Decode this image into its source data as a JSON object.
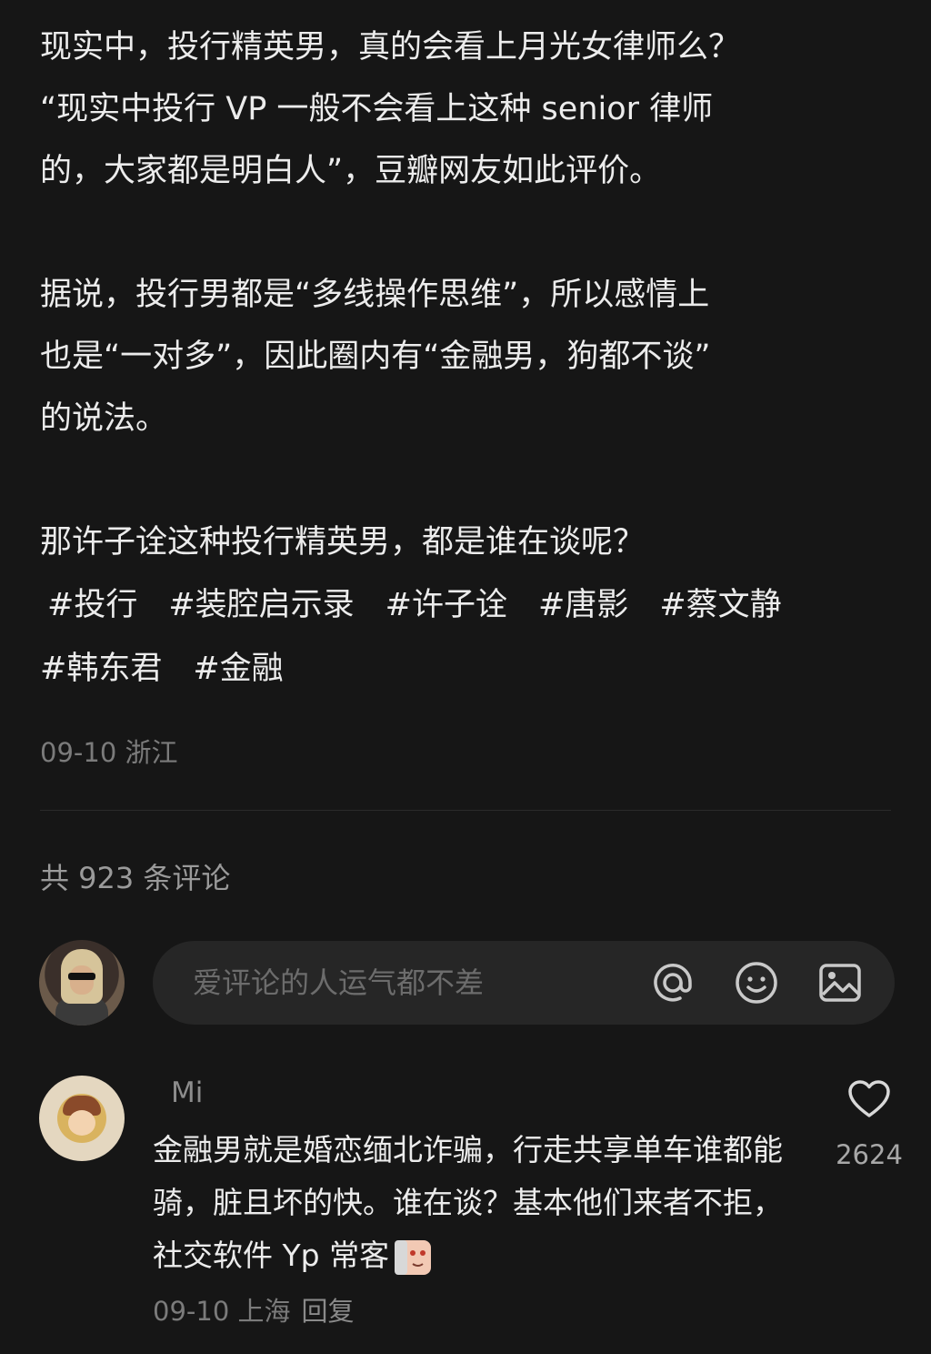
{
  "post": {
    "paragraphs": [
      [
        "现实中，投行精英男，真的会看上月光女律师么？",
        "“现实中投行 VP 一般不会看上这种 senior 律师",
        "的，大家都是明白人”，豆瓣网友如此评价。"
      ],
      [
        "据说，投行男都是“多线操作思维”，所以感情上",
        "也是“一对多”，因此圈内有“金融男，狗都不谈”",
        "的说法。"
      ],
      [
        "那许子诠这种投行精英男，都是谁在谈呢？"
      ]
    ],
    "tags": [
      "#投行",
      "#装腔启示录",
      "#许子诠",
      "#唐影",
      "#蔡文静",
      "#韩东君",
      "#金融"
    ],
    "meta": "09-10 浙江"
  },
  "comments_count": "共 923 条评论",
  "composer": {
    "placeholder": "爱评论的人运气都不差",
    "icons": [
      "at-icon",
      "emoji-icon",
      "image-icon"
    ]
  },
  "comment": {
    "author": "Mi",
    "text": "金融男就是婚恋缅北诈骗，行走共享单车谁都能骑，脏且坏的快。谁在谈？基本他们来者不拒，社交软件 Yp 常客",
    "date_location": "09-10 上海",
    "reply_label": "回复",
    "likes": "2624"
  },
  "colors": {
    "background": "#161616",
    "text": "#ececec",
    "muted": "#7b7b7b",
    "input_bg": "#262626"
  }
}
